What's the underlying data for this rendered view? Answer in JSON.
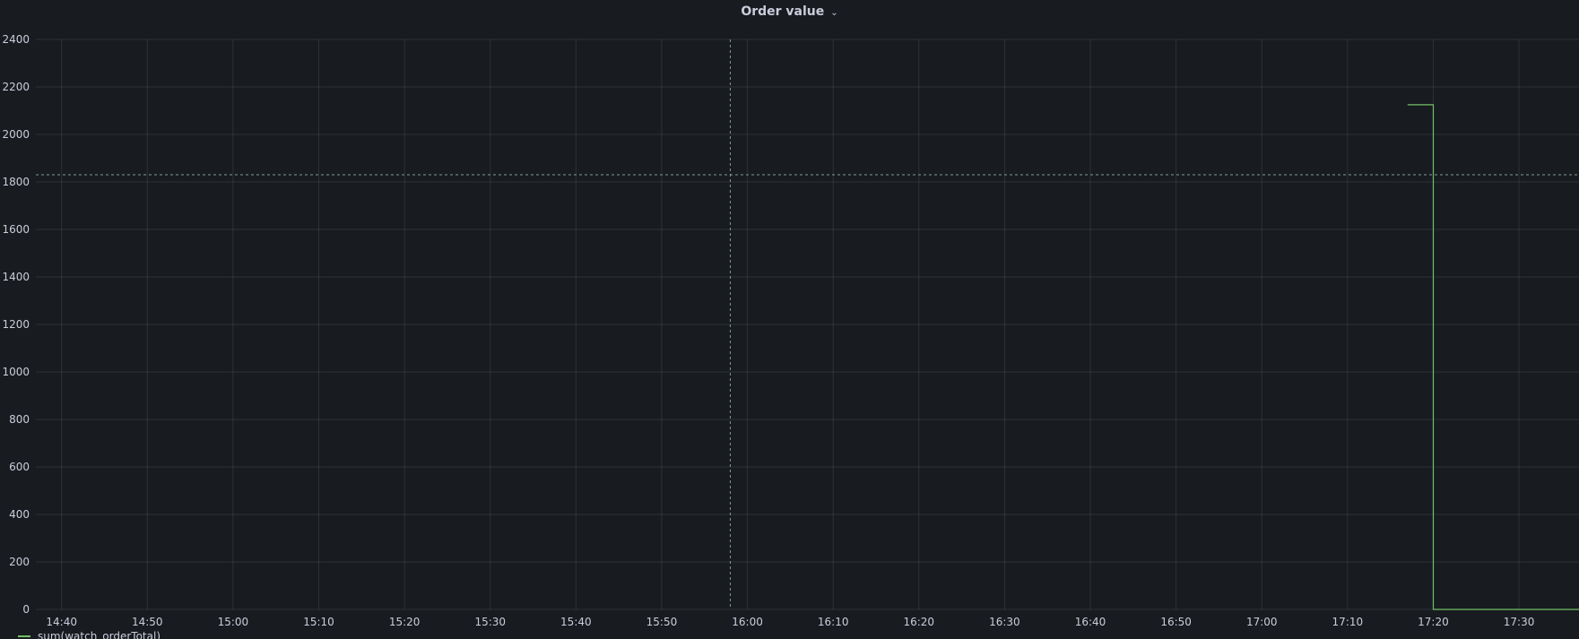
{
  "panel": {
    "title": "Order value",
    "menu_icon": "chevron-down-icon"
  },
  "chart_data": {
    "type": "line",
    "title": "Order value",
    "xlabel": "",
    "ylabel": "",
    "ylim": [
      0,
      2400
    ],
    "yticks": [
      0,
      200,
      400,
      600,
      800,
      1000,
      1200,
      1400,
      1600,
      1800,
      2000,
      2200,
      2400
    ],
    "xlim": [
      "14:37",
      "17:37"
    ],
    "xticks": [
      "14:40",
      "14:50",
      "15:00",
      "15:10",
      "15:20",
      "15:30",
      "15:40",
      "15:50",
      "16:00",
      "16:10",
      "16:20",
      "16:30",
      "16:40",
      "16:50",
      "17:00",
      "17:10",
      "17:20",
      "17:30"
    ],
    "grid": true,
    "series": [
      {
        "name": "sum(watch_orderTotal)",
        "color": "#73bf69",
        "interpolation": "step",
        "points": [
          {
            "x": "17:17",
            "y": 2125
          },
          {
            "x": "17:20",
            "y": 2125
          },
          {
            "x": "17:20",
            "y": 0
          },
          {
            "x": "17:37",
            "y": 0
          }
        ]
      }
    ],
    "crosshair": {
      "x": "15:58",
      "y": 1830
    }
  },
  "legend": {
    "placement": "bottom-left",
    "items": [
      {
        "label": "sum(watch_orderTotal)",
        "color": "#73bf69"
      }
    ]
  }
}
